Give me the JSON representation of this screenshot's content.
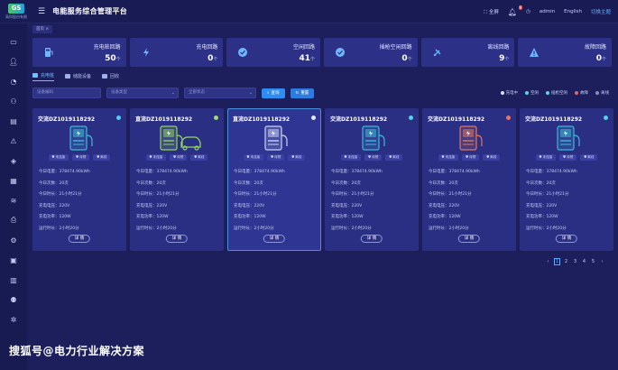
{
  "app": {
    "logo_mark": "GS",
    "logo_text": "高科股份有限",
    "title": "电能服务综合管理平台"
  },
  "topbar": {
    "fullscreen": "全屏",
    "notifications_count": "9",
    "user": "admin",
    "lang_en": "English",
    "lang_switch": "切换主题"
  },
  "breadcrumb": "首页  ×",
  "stats": [
    {
      "label": "充电桩回路",
      "value": "50",
      "unit": "个",
      "icon": "charging-pile-icon",
      "color": "#6fb7ff"
    },
    {
      "label": "充电回路",
      "value": "0",
      "unit": "个",
      "icon": "lightning-icon",
      "color": "#6fb7ff"
    },
    {
      "label": "空闲回路",
      "value": "41",
      "unit": "个",
      "icon": "check-circle-icon",
      "color": "#6fb7ff"
    },
    {
      "label": "插枪空闲回路",
      "value": "0",
      "unit": "个",
      "icon": "check-circle-icon",
      "color": "#6fb7ff"
    },
    {
      "label": "离线回路",
      "value": "9",
      "unit": "个",
      "icon": "offline-plug-icon",
      "color": "#6fb7ff"
    },
    {
      "label": "故障回路",
      "value": "0",
      "unit": "个",
      "icon": "warning-icon",
      "color": "#6fb7ff"
    }
  ],
  "tabs": [
    "充电桩",
    "储能设备",
    "回收"
  ],
  "filters": {
    "name_placeholder": "设备编码",
    "type_placeholder": "设备类型",
    "status_placeholder": "全部状态",
    "query_label": "查询",
    "reset_label": "重置"
  },
  "legend": [
    {
      "label": "充电中",
      "color": "#dbe1ff"
    },
    {
      "label": "空闲",
      "color": "#5fd4ea"
    },
    {
      "label": "插枪空闲",
      "color": "#5fd4ea"
    },
    {
      "label": "故障",
      "color": "#e06a6a"
    },
    {
      "label": "离线",
      "color": "#8890b8"
    }
  ],
  "cards": [
    {
      "title": "交流DZ1019118292",
      "status_color": "#4fd1e8",
      "accent": "#3db9d8",
      "selected": false
    },
    {
      "title": "直流DZ1019118292",
      "status_color": "#9edc6c",
      "accent": "#8ed35a",
      "selected": false
    },
    {
      "title": "直流DZ1019118292",
      "status_color": "#e6e9ff",
      "accent": "#c9d1f5",
      "selected": true
    },
    {
      "title": "交流DZ1019118292",
      "status_color": "#4fd1e8",
      "accent": "#3db9d8",
      "selected": false
    },
    {
      "title": "交流DZ1019118292",
      "status_color": "#e8735e",
      "accent": "#e0775f",
      "selected": false
    },
    {
      "title": "交流DZ1019118292",
      "status_color": "#4fd1e8",
      "accent": "#3db9d8",
      "selected": false
    }
  ],
  "card_buttons": [
    "未连接",
    "待预",
    "离线"
  ],
  "card_rows": {
    "energy": "今日电量：378474.90kWh",
    "count": "今日次数：20次",
    "duration": "今日时长：21小时21分",
    "voltage": "充电电压：220V",
    "power": "充电功率：120W",
    "runtime": "运行时长：2小时20分"
  },
  "detail_label": "详 情",
  "pager": [
    "‹",
    "1",
    "2",
    "3",
    "4",
    "5",
    "›"
  ],
  "watermark": "搜狐号@电力行业解决方案"
}
